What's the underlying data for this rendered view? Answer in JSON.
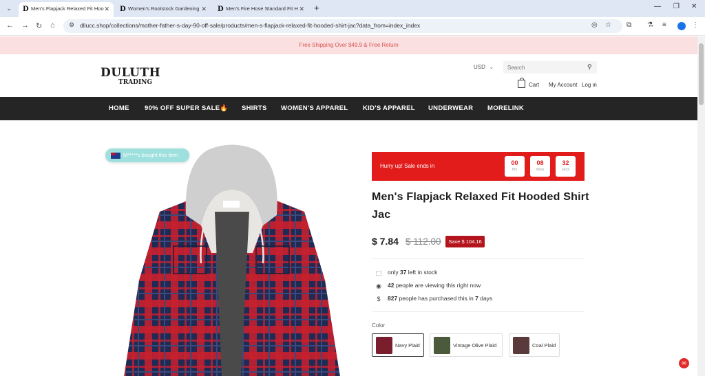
{
  "browser": {
    "tabs": [
      {
        "title": "Men's Flapjack Relaxed Fit Hoo"
      },
      {
        "title": "Women's Rootstock Gardening"
      },
      {
        "title": "Men's Fire Hose Standard Fit H"
      }
    ],
    "url": "dllucc.shop/collections/mother-father-s-day-90-off-sale/products/men-s-flapjack-relaxed-fit-hooded-shirt-jac?data_from=index_index"
  },
  "promo": {
    "text": "Free Shipping Over $49.9 & Free Return"
  },
  "header": {
    "logo_line1": "DULUTH",
    "logo_line2": "TRADING",
    "currency": "USD",
    "search_placeholder": "Search",
    "cart": "Cart",
    "account": "My Account",
    "login": "Log in"
  },
  "nav": {
    "items": [
      "HOME",
      "90% OFF SUPER SALE",
      "SHIRTS",
      "WOMEN'S APPAREL",
      "KID'S APPAREL",
      "UNDERWEAR",
      "MORELINK"
    ],
    "fire_icon": "🔥"
  },
  "badge": {
    "bought": "M*****s bought this item"
  },
  "countdown": {
    "text": "Hurry up!  Sale ends in",
    "hours": "00",
    "hours_unit": "hrs",
    "mins": "08",
    "mins_unit": "mins",
    "secs": "32",
    "secs_unit": "secs"
  },
  "product": {
    "title": "Men's Flapjack Relaxed Fit Hooded Shirt Jac",
    "price": "$ 7.84",
    "compare_price": "$ 112.00",
    "save": "Save $ 104.16"
  },
  "info": {
    "stock_pre": "only ",
    "stock_num": "37",
    "stock_post": " left in stock",
    "viewing_num": "42",
    "viewing_post": " people are viewing this right now",
    "purchased_num": "827",
    "purchased_mid": " people has purchased this in ",
    "purchased_days": "7",
    "purchased_post": " days"
  },
  "color": {
    "label": "Color",
    "options": [
      {
        "name": "Navy Plaid",
        "color": "#7a1e2e"
      },
      {
        "name": "Vintage Olive Plaid",
        "color": "#4a5a3a"
      },
      {
        "name": "Coal Plaid",
        "color": "#5a3a3a"
      }
    ]
  },
  "colors": {
    "accent": "#e21b1b",
    "nav_bg": "#252525",
    "promo_bg": "#fae0e0"
  }
}
